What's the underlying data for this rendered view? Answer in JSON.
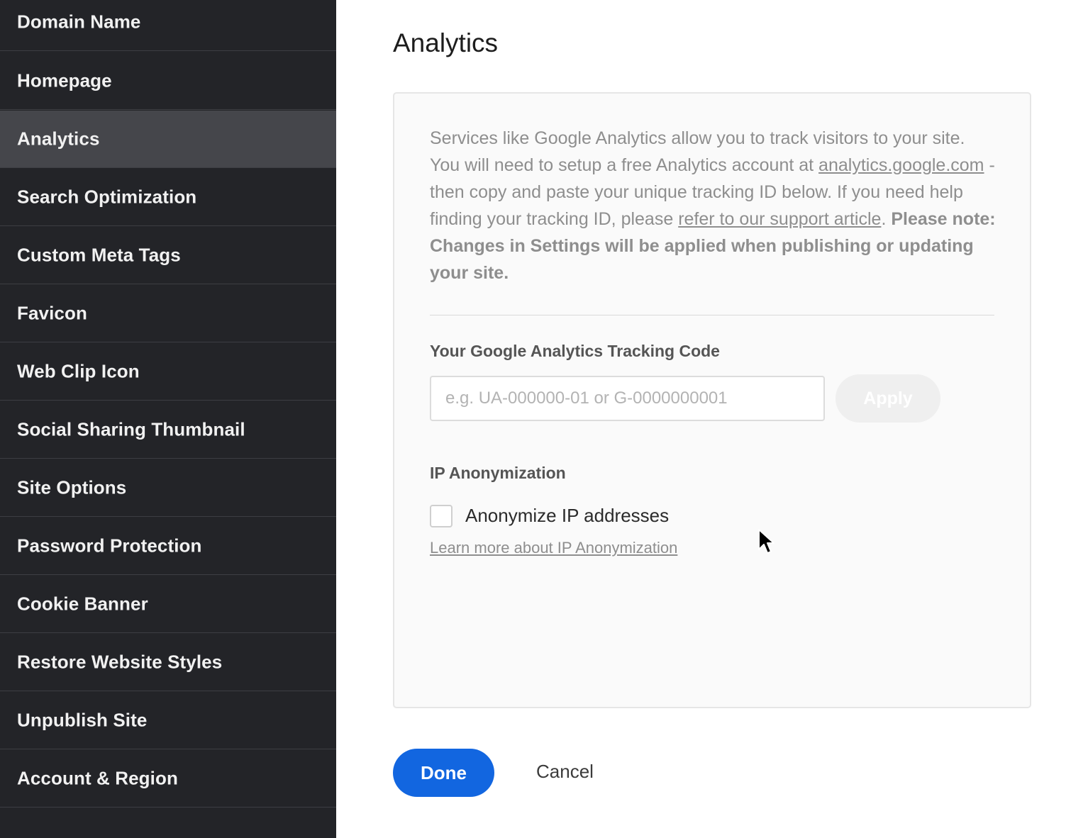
{
  "sidebar": {
    "items": [
      {
        "label": "Domain Name",
        "active": false
      },
      {
        "label": "Homepage",
        "active": false
      },
      {
        "label": "Analytics",
        "active": true
      },
      {
        "label": "Search Optimization",
        "active": false
      },
      {
        "label": "Custom Meta Tags",
        "active": false
      },
      {
        "label": "Favicon",
        "active": false
      },
      {
        "label": "Web Clip Icon",
        "active": false
      },
      {
        "label": "Social Sharing Thumbnail",
        "active": false
      },
      {
        "label": "Site Options",
        "active": false
      },
      {
        "label": "Password Protection",
        "active": false
      },
      {
        "label": "Cookie Banner",
        "active": false
      },
      {
        "label": "Restore Website Styles",
        "active": false
      },
      {
        "label": "Unpublish Site",
        "active": false
      },
      {
        "label": "Account & Region",
        "active": false
      }
    ]
  },
  "main": {
    "title": "Analytics",
    "description": {
      "intro": "Services like Google Analytics allow you to track visitors to your site. You will need to setup a free Analytics account at ",
      "link1": "analytics.google.com",
      "middle": " - then copy and paste your unique tracking ID below. If you need help finding your tracking ID, please ",
      "link2": "refer to our support article",
      "after_link2": ". ",
      "note": "Please note: Changes in Settings will be applied when publishing or updating your site."
    },
    "tracking": {
      "label": "Your Google Analytics Tracking Code",
      "value": "",
      "placeholder": "e.g. UA-000000-01 or G-0000000001",
      "apply_label": "Apply"
    },
    "ip": {
      "heading": "IP Anonymization",
      "checkbox_label": "Anonymize IP addresses",
      "checked": false,
      "learn_more": "Learn more about IP Anonymization"
    }
  },
  "footer": {
    "done_label": "Done",
    "cancel_label": "Cancel"
  },
  "colors": {
    "sidebar_bg": "#232428",
    "sidebar_active": "#45464b",
    "primary": "#1266e0",
    "muted_text": "#8e8e8e"
  }
}
